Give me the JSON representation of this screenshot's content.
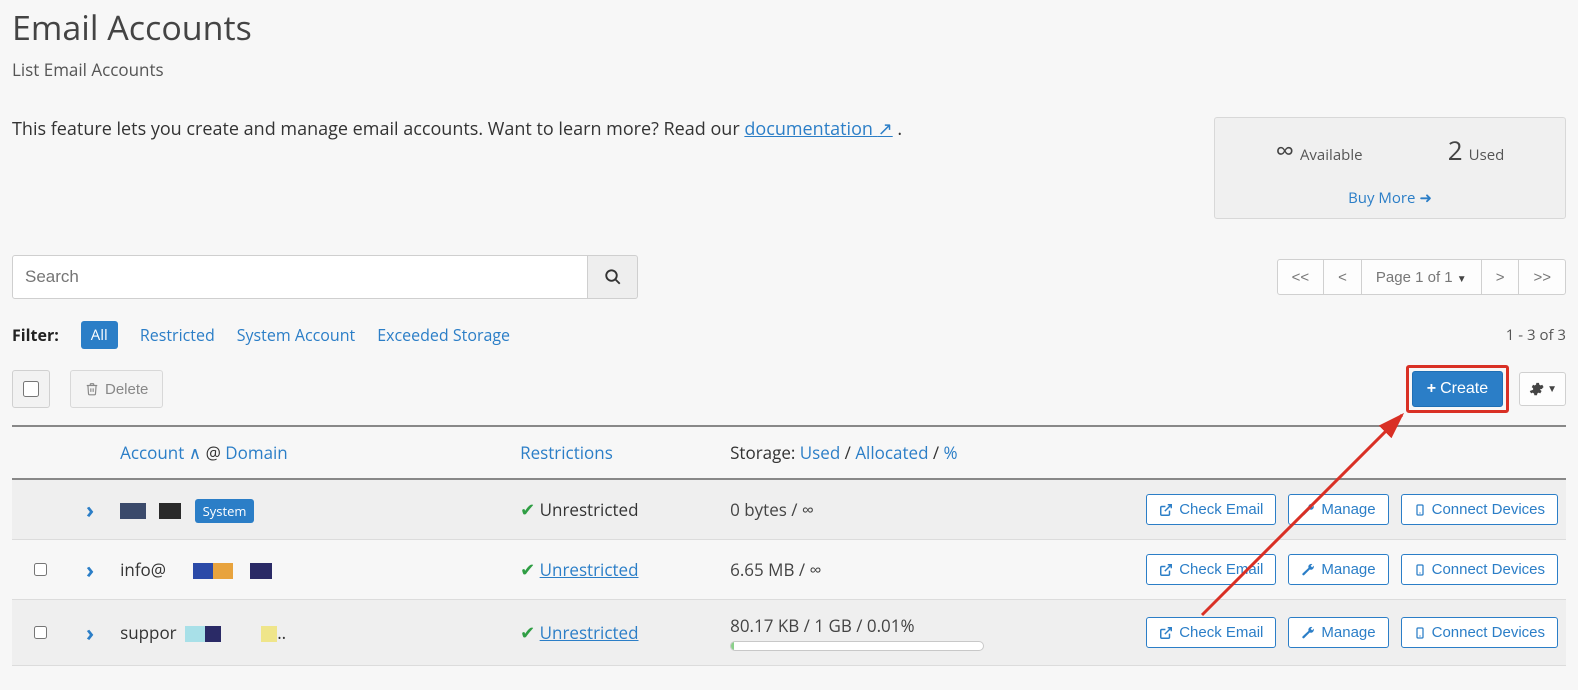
{
  "header": {
    "title": "Email Accounts",
    "subtitle": "List Email Accounts"
  },
  "description": {
    "prefix": "This feature lets you create and manage email accounts. Want to learn more? Read our ",
    "link_text": "documentation",
    "suffix": " ."
  },
  "stats": {
    "available_symbol": "∞",
    "available_label": "Available",
    "used_value": "2",
    "used_label": "Used",
    "buy_more": "Buy More"
  },
  "search": {
    "placeholder": "Search"
  },
  "pager": {
    "first": "<<",
    "prev": "<",
    "page_label": "Page 1 of 1",
    "next": ">",
    "last": ">>"
  },
  "filter": {
    "label": "Filter:",
    "all": "All",
    "restricted": "Restricted",
    "system": "System Account",
    "exceeded": "Exceeded Storage",
    "count_text": "1 - 3 of 3"
  },
  "actions": {
    "delete": "Delete",
    "create": "Create"
  },
  "table": {
    "header": {
      "account": "Account",
      "at": "@",
      "domain": "Domain",
      "restrictions": "Restrictions",
      "storage_prefix": "Storage:",
      "used": "Used",
      "allocated": "Allocated",
      "percent": "%"
    },
    "row_action_labels": {
      "check_email": "Check Email",
      "manage": "Manage",
      "connect": "Connect Devices"
    },
    "rows": [
      {
        "account_text": "",
        "system_badge": "System",
        "restriction": "Unrestricted",
        "restriction_link": false,
        "storage": "0 bytes / ∞",
        "has_progress": false,
        "has_checkbox": false
      },
      {
        "account_text": "info@",
        "system_badge": "",
        "restriction": "Unrestricted",
        "restriction_link": true,
        "storage": "6.65 MB / ∞",
        "has_progress": false,
        "has_checkbox": true
      },
      {
        "account_text": "suppor",
        "system_badge": "",
        "restriction": "Unrestricted",
        "restriction_link": true,
        "storage": "80.17 KB / 1 GB / 0.01%",
        "has_progress": true,
        "has_checkbox": true
      }
    ]
  }
}
